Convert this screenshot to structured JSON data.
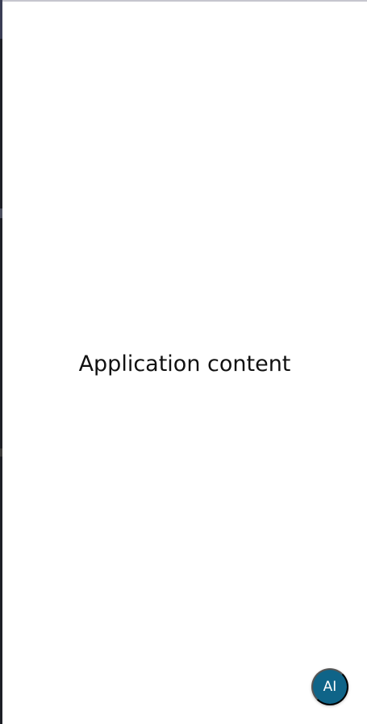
{
  "main": {
    "content_text": "Application content"
  },
  "assistant_button": {
    "label": "AI",
    "color": "#0f6488"
  }
}
